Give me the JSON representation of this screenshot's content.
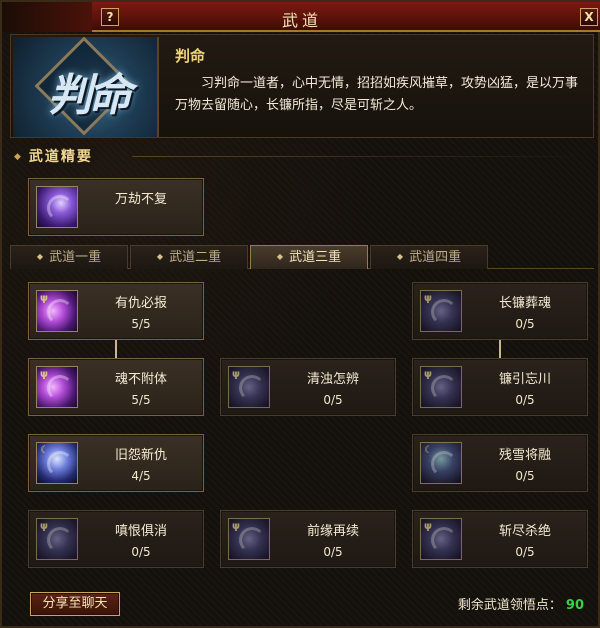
{
  "window": {
    "title": "武道"
  },
  "titlebar": {
    "help_label": "?",
    "close_label": "X"
  },
  "header": {
    "emblem_text": "判命",
    "skill_name": "判命",
    "description": "习判命一道者，心中无情，招招如疾风摧草，攻势凶猛，是以万事万物去留随心，长镰所指，尽是可斩之人。"
  },
  "essentials": {
    "title": "武道精要",
    "item": {
      "name": "万劫不复",
      "icon": "purple-swirl-icon"
    }
  },
  "tabs": [
    {
      "label": "武道一重",
      "active": false
    },
    {
      "label": "武道二重",
      "active": false
    },
    {
      "label": "武道三重",
      "active": true
    },
    {
      "label": "武道四重",
      "active": false
    }
  ],
  "skills": [
    {
      "name": "有仇必报",
      "level": "5/5",
      "active": true
    },
    {
      "name": "长镰葬魂",
      "level": "0/5",
      "active": false
    },
    {
      "name": "魂不附体",
      "level": "5/5",
      "active": true
    },
    {
      "name": "清浊怎辨",
      "level": "0/5",
      "active": false
    },
    {
      "name": "镰引忘川",
      "level": "0/5",
      "active": false
    },
    {
      "name": "旧怨新仇",
      "level": "4/5",
      "active": true
    },
    {
      "name": "残雪将融",
      "level": "0/5",
      "active": false
    },
    {
      "name": "嗔恨俱消",
      "level": "0/5",
      "active": false
    },
    {
      "name": "前缘再续",
      "level": "0/5",
      "active": false
    },
    {
      "name": "斩尽杀绝",
      "level": "0/5",
      "active": false
    }
  ],
  "footer": {
    "share_label": "分享至聊天",
    "points_label": "剩余武道领悟点：",
    "points_value": "90",
    "points_color": "#38d04a"
  },
  "colors": {
    "title_bar": "#7a1a10",
    "gold_text": "#f1d27a",
    "panel_border": "#7a6240"
  }
}
